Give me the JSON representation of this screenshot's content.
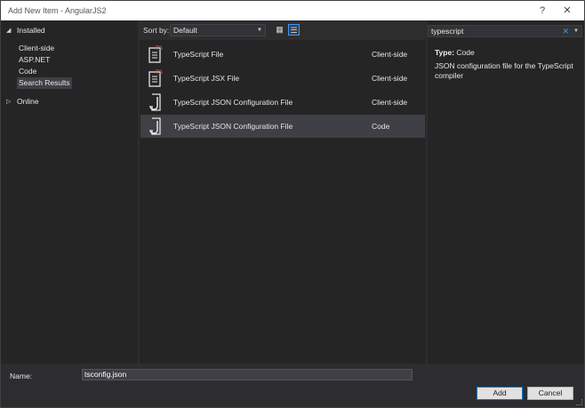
{
  "titlebar": {
    "title": "Add New Item - AngularJS2",
    "help_glyph": "?",
    "close_glyph": "✕"
  },
  "tree": {
    "installed": "Installed",
    "children": [
      "Client-side",
      "ASP.NET",
      "Code",
      "Search Results"
    ],
    "online": "Online"
  },
  "toolbar": {
    "sort_label": "Sort by:",
    "sort_value": "Default"
  },
  "items": [
    {
      "name": "TypeScript File",
      "category": "Client-side",
      "icon": "typescript-file-icon"
    },
    {
      "name": "TypeScript JSX File",
      "category": "Client-side",
      "icon": "typescript-file-icon"
    },
    {
      "name": "TypeScript JSON Configuration File",
      "category": "Client-side",
      "icon": "json-config-icon"
    },
    {
      "name": "TypeScript JSON Configuration File",
      "category": "Code",
      "icon": "json-config-icon"
    }
  ],
  "search": {
    "value": "typescript"
  },
  "details": {
    "type_label": "Type:",
    "type_value": "Code",
    "description": "JSON configuration file for the TypeScript compiler"
  },
  "footer": {
    "name_label": "Name:",
    "name_value": "tsconfig.json",
    "add_label": "Add",
    "cancel_label": "Cancel"
  },
  "colors": {
    "accent": "#3399ff",
    "ts_badge": "#e8502d",
    "selection": "#3f3f46",
    "panel": "#252526"
  }
}
